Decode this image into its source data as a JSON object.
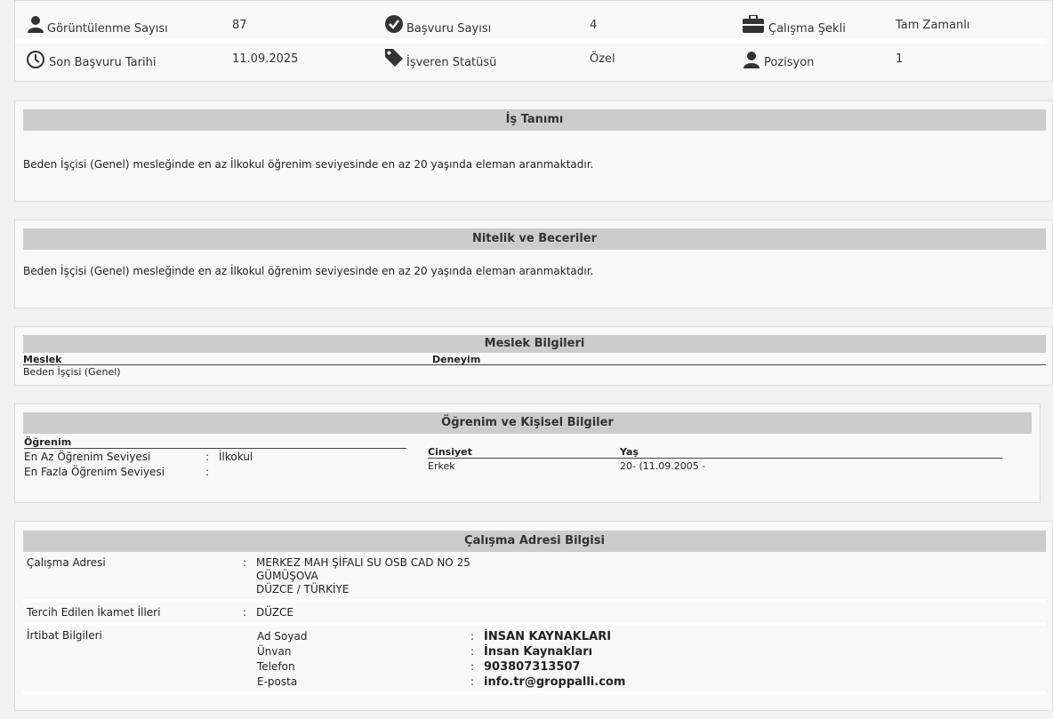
{
  "stats": {
    "views_label": "Görüntülenme Sayısı",
    "views_value": "87",
    "applications_label": "Başvuru Sayısı",
    "applications_value": "4",
    "work_type_label": "Çalışma Şekli",
    "work_type_value": "Tam Zamanlı",
    "deadline_label": "Son Başvuru Tarihi",
    "deadline_value": "11.09.2025",
    "employer_status_label": "İşveren Statüsü",
    "employer_status_value": "Özel",
    "positions_label": "Pozisyon",
    "positions_value": "1"
  },
  "job_description": {
    "title": "İş Tanımı",
    "text": "Beden İşçisi (Genel) mesleğinde en az İlkokul öğrenim seviyesinde en az 20 yaşında eleman aranmaktadır."
  },
  "skills": {
    "title": "Nitelik ve Beceriler",
    "text": "Beden İşçisi (Genel) mesleğinde en az İlkokul öğrenim seviyesinde en az 20 yaşında eleman aranmaktadır."
  },
  "occupation": {
    "title": "Meslek Bilgileri",
    "col_occupation": "Meslek",
    "col_experience": "Deneyim",
    "occupation_value": "Beden İşçisi (Genel)"
  },
  "education": {
    "title": "Öğrenim ve Kişisel Bilgiler",
    "education_header": "Öğrenim",
    "min_label": "En Az Öğrenim Seviyesi",
    "min_value": "İlkokul",
    "max_label": "En Fazla Öğrenim Seviyesi",
    "max_value": "",
    "separator": ":",
    "gender_header": "Cinsiyet",
    "gender_value": "Erkek",
    "age_header": "Yaş",
    "age_value": "20- (11.09.2005 -"
  },
  "address": {
    "title": "Çalışma Adresi Bilgisi",
    "separator": ":",
    "work_address_label": "Çalışma Adresi",
    "work_address_line1": "MERKEZ MAH ŞİFALI SU OSB CAD NO 25",
    "work_address_line2": "GÜMÜŞOVA",
    "work_address_line3": "DÜZCE / TÜRKİYE",
    "residence_label": "Tercih Edilen İkamet İlleri",
    "residence_value": "DÜZCE",
    "contact_label": "İrtibat Bilgileri",
    "contact": {
      "name_label": "Ad Soyad",
      "name_value": "İNSAN KAYNAKLARI",
      "title_label": "Ünvan",
      "title_value": "İnsan Kaynakları",
      "phone_label": "Telefon",
      "phone_value": "903807313507",
      "email_label": "E-posta",
      "email_value": "info.tr@groppalli.com"
    }
  }
}
